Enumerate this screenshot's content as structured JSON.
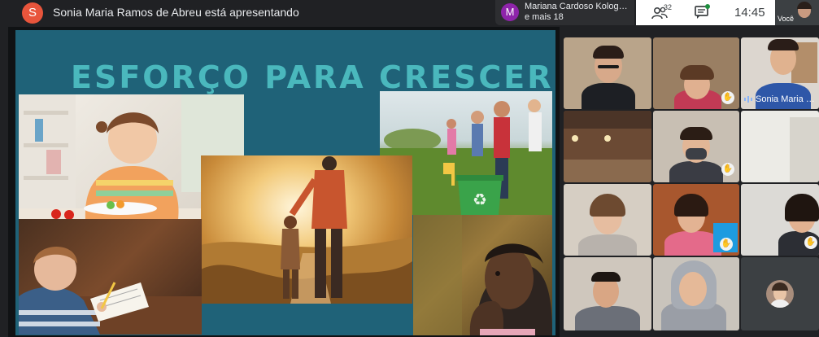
{
  "topbar": {
    "presenter_initial": "S",
    "presenter_text": "Sonia Maria Ramos de Abreu está apresentando",
    "participant_chip": {
      "initial": "M",
      "name": "Mariana Cardoso Kolog…",
      "more": "e mais 18"
    },
    "people_count": "32",
    "time": "14:45",
    "self_label": "Você"
  },
  "slide": {
    "title": "ESFORÇO PARA CRESCER"
  },
  "participants": {
    "speaker_name": "Sonia Maria …"
  },
  "colors": {
    "slide_background": "#1f6278",
    "title_color": "#4ab8bd",
    "presenter_avatar": "#e8553c",
    "chip_avatar": "#8e24aa",
    "chat_dot": "#1e8e3e"
  },
  "icons": [
    "people-icon",
    "chat-icon",
    "hand-raised-icon",
    "mic-active-icon"
  ]
}
